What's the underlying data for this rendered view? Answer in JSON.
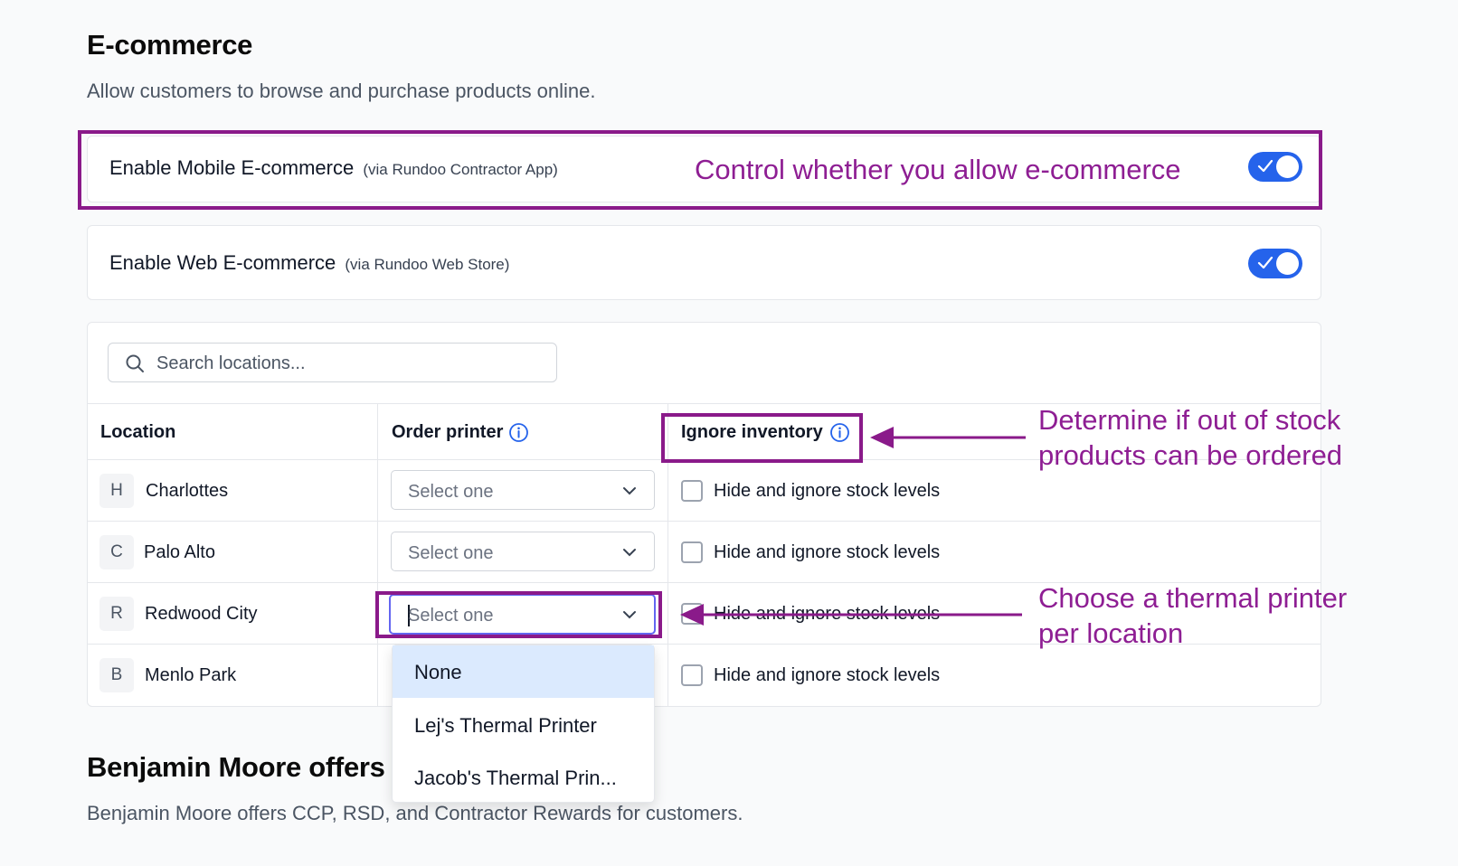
{
  "section_ecommerce": {
    "title": "E-commerce",
    "subtitle": "Allow customers to browse and purchase products online."
  },
  "mobile_toggle": {
    "label": "Enable Mobile E-commerce",
    "sublabel": "(via Rundoo Contractor App)",
    "enabled": true
  },
  "web_toggle": {
    "label": "Enable Web E-commerce",
    "sublabel": "(via Rundoo Web Store)",
    "enabled": true
  },
  "search": {
    "placeholder": "Search locations..."
  },
  "table": {
    "headers": {
      "location": "Location",
      "order_printer": "Order printer",
      "ignore_inventory": "Ignore inventory"
    },
    "rows": [
      {
        "initial": "H",
        "name": "Charlottes",
        "printer": "Select one",
        "checkbox_label": "Hide and ignore stock levels"
      },
      {
        "initial": "C",
        "name": "Palo Alto",
        "printer": "Select one",
        "checkbox_label": "Hide and ignore stock levels"
      },
      {
        "initial": "R",
        "name": "Redwood City",
        "printer": "Select one",
        "checkbox_label": "Hide and ignore stock levels"
      },
      {
        "initial": "B",
        "name": "Menlo Park",
        "printer": "",
        "checkbox_label": "Hide and ignore stock levels"
      }
    ]
  },
  "printer_dropdown": {
    "options": [
      "None",
      "Lej's Thermal Printer",
      "Jacob's Thermal Prin..."
    ],
    "highlighted": "None"
  },
  "section_offers": {
    "title": "Benjamin Moore offers",
    "subtitle": "Benjamin Moore offers CCP, RSD, and Contractor Rewards for customers."
  },
  "annotations": {
    "ecommerce": "Control whether you allow e-commerce",
    "inventory_line1": "Determine if out of stock",
    "inventory_line2": "products can be ordered",
    "printer_line1": "Choose a thermal printer",
    "printer_line2": "per location"
  },
  "colors": {
    "accent": "#2563eb",
    "annotation": "#8e1e93",
    "dropdown_highlight": "#dbeafe"
  }
}
